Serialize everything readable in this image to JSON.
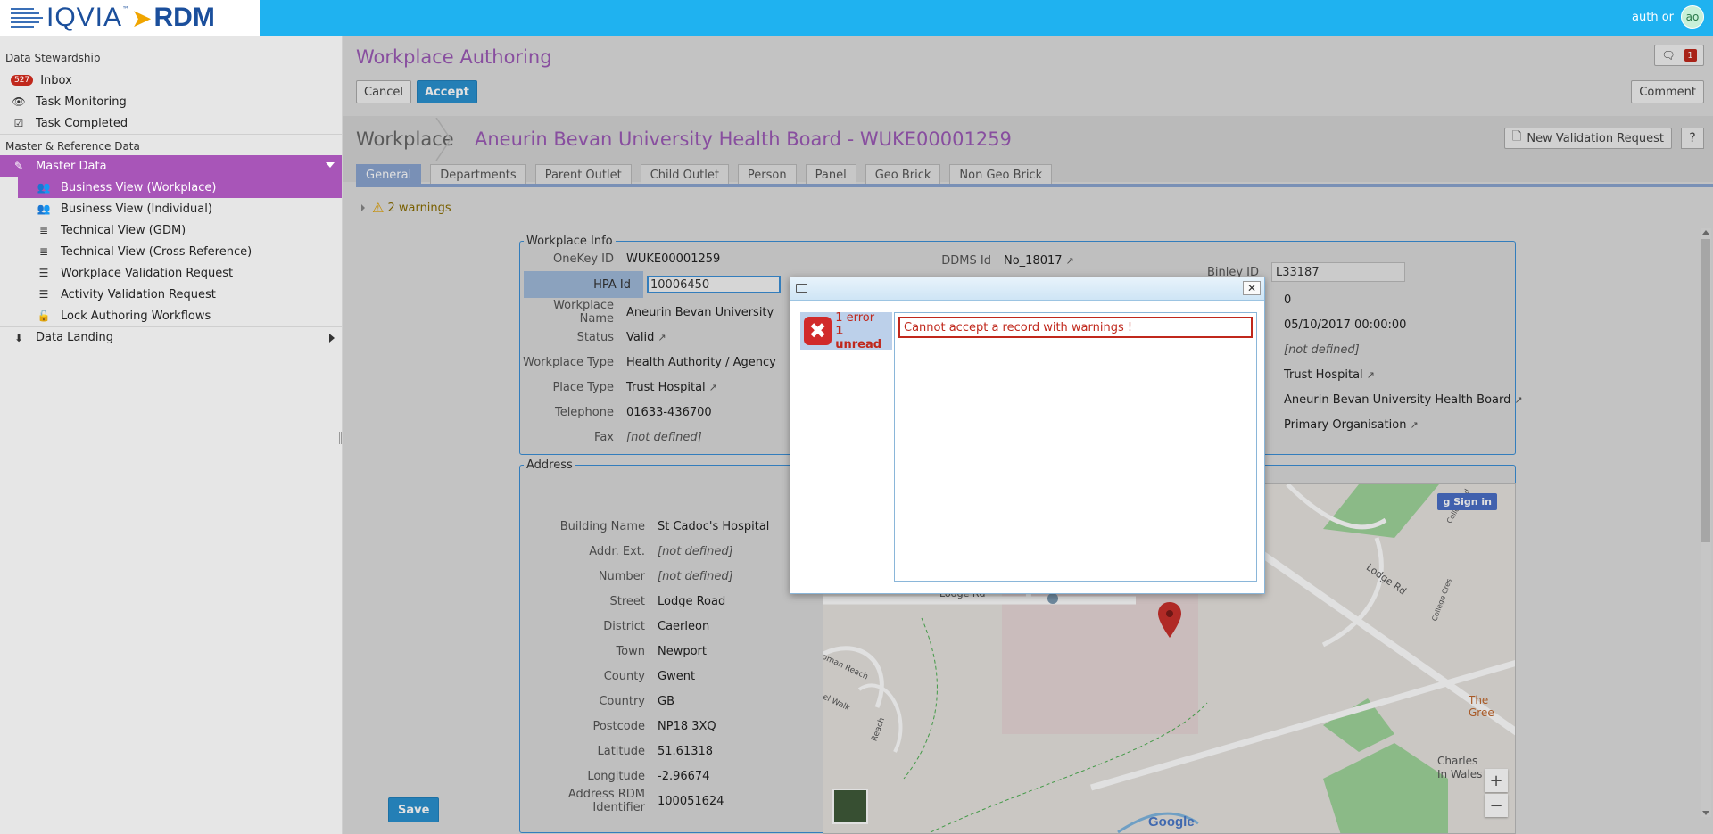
{
  "header": {
    "logo_text": "IQVIA",
    "logo_tm": "™",
    "logo_product": "RDM",
    "user_label": "auth or",
    "avatar_initials": "ao"
  },
  "sidebar": {
    "section1": "Data Stewardship",
    "inbox_count": "527",
    "inbox": "Inbox",
    "task_monitoring": "Task Monitoring",
    "task_completed": "Task Completed",
    "section2": "Master & Reference Data",
    "master_data": "Master Data",
    "items": [
      "Business View (Workplace)",
      "Business View (Individual)",
      "Technical View (GDM)",
      "Technical View (Cross Reference)",
      "Workplace Validation Request",
      "Activity Validation Request",
      "Lock Authoring Workflows"
    ],
    "data_landing": "Data Landing"
  },
  "page": {
    "title": "Workplace Authoring",
    "cancel": "Cancel",
    "accept": "Accept",
    "comment": "Comment",
    "notif_count": "1",
    "entity_type": "Workplace",
    "entity_name": "Aneurin Bevan University Health Board - WUKE00001259",
    "new_validation": "New Validation Request",
    "help": "?",
    "tabs": [
      "General",
      "Departments",
      "Parent Outlet",
      "Child Outlet",
      "Person",
      "Panel",
      "Geo Brick",
      "Non Geo Brick"
    ],
    "warnings": "2 warnings",
    "save": "Save"
  },
  "workplace_info": {
    "legend": "Workplace Info",
    "onekey_label": "OneKey ID",
    "onekey": "WUKE00001259",
    "hpa_label": "HPA Id",
    "hpa": "10006450",
    "name_label": "Workplace Name",
    "name": "Aneurin Bevan University",
    "status_label": "Status",
    "status": "Valid",
    "type_label": "Workplace Type",
    "type": "Health Authority / Agency",
    "place_label": "Place Type",
    "place": "Trust Hospital",
    "tel_label": "Telephone",
    "tel": "01633-436700",
    "fax_label": "Fax",
    "fax": "[not defined]",
    "ddms_label": "DDMS Id",
    "ddms": "No_18017",
    "binley_label": "Binley ID",
    "binley": "L33187",
    "r_zero": "0",
    "r_date": "05/10/2017 00:00:00",
    "r_nd": "[not defined]",
    "r_trust": "Trust Hospital",
    "r_parent": "Aneurin Bevan University Health Board",
    "r_primary": "Primary Organisation"
  },
  "address": {
    "legend": "Address",
    "rows": [
      {
        "label": "Building Name",
        "value": "St Cadoc's Hospital"
      },
      {
        "label": "Addr. Ext.",
        "value": "[not defined]"
      },
      {
        "label": "Number",
        "value": "[not defined]"
      },
      {
        "label": "Street",
        "value": "Lodge Road"
      },
      {
        "label": "District",
        "value": "Caerleon"
      },
      {
        "label": "Town",
        "value": "Newport"
      },
      {
        "label": "County",
        "value": "Gwent"
      },
      {
        "label": "Country",
        "value": "GB"
      },
      {
        "label": "Postcode",
        "value": "NP18 3XQ"
      },
      {
        "label": "Latitude",
        "value": "51.61318"
      },
      {
        "label": "Longitude",
        "value": "-2.96674"
      },
      {
        "label": "Address RDM Identifier",
        "value": "100051624"
      }
    ]
  },
  "map": {
    "signin": "Sign in",
    "lodge_rd": "Lodge Rd",
    "lodge_rd2": "Lodge Rd",
    "college_cres": "College Cres",
    "college_rd": "College Rd",
    "the_green": "The Gree",
    "charles": "Charles",
    "in_wales": "In Wales",
    "reach": "Reach",
    "walk": "el Walk",
    "oman_reach": "oman Reach",
    "zoom_in": "+",
    "zoom_out": "−",
    "google": "Google"
  },
  "dialog": {
    "error_count": "1 error",
    "unread_count": "1 unread",
    "message": "Cannot accept a record with warnings !",
    "close": "✕"
  }
}
